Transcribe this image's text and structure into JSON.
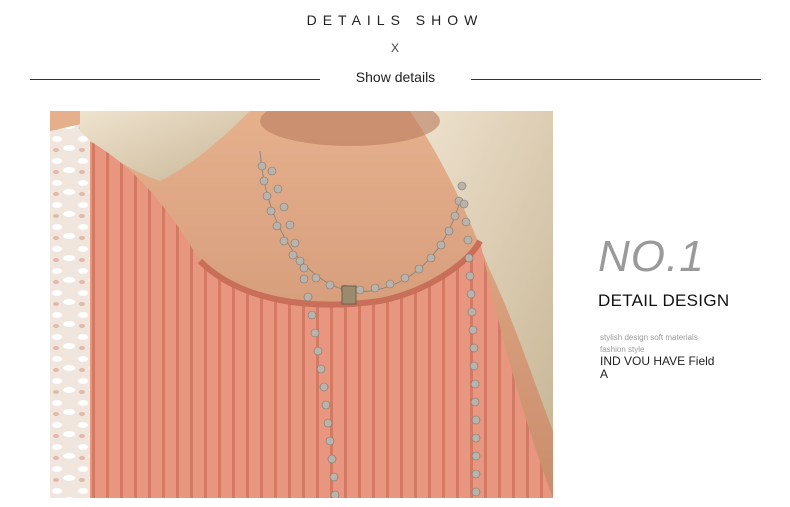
{
  "header": {
    "title": "DETAILS SHOW",
    "x_mark": "X",
    "subtitle": "Show details"
  },
  "detail": {
    "number_label": "NO.1",
    "heading": "DETAIL DESIGN",
    "small_line_1": "stylish design soft materials",
    "small_line_2": "fashion style",
    "field_line_1": "IND VOU HAVE Field",
    "field_line_2": "A"
  },
  "colors": {
    "top_fabric": "#e8967f",
    "rib_shadow": "#d27a64",
    "skin": "#d9a07f",
    "hair": "#e6d7bf",
    "pearl": "#b9b3ab",
    "title_gray": "#9a9a9a"
  }
}
